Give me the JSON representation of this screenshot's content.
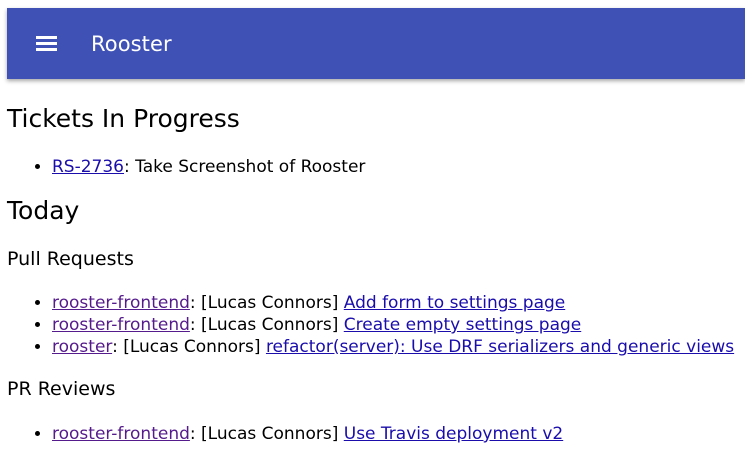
{
  "app": {
    "title": "Rooster"
  },
  "colors": {
    "appbar": "#3f51b5",
    "link": "#1a0dab",
    "visited_link": "#551a8b"
  },
  "in_progress": {
    "heading": "Tickets In Progress",
    "items": [
      {
        "key": "RS-2736",
        "sep": ": ",
        "summary": "Take Screenshot of Rooster"
      }
    ]
  },
  "today": {
    "heading": "Today",
    "pull_requests": {
      "heading": "Pull Requests",
      "items": [
        {
          "repo": "rooster-frontend",
          "author": ": [Lucas Connors] ",
          "title": "Add form to settings page"
        },
        {
          "repo": "rooster-frontend",
          "author": ": [Lucas Connors] ",
          "title": "Create empty settings page"
        },
        {
          "repo": "rooster",
          "author": ": [Lucas Connors] ",
          "title": "refactor(server): Use DRF serializers and generic views"
        }
      ]
    },
    "pr_reviews": {
      "heading": "PR Reviews",
      "items": [
        {
          "repo": "rooster-frontend",
          "author": ": [Lucas Connors] ",
          "title": "Use Travis deployment v2"
        }
      ]
    }
  }
}
